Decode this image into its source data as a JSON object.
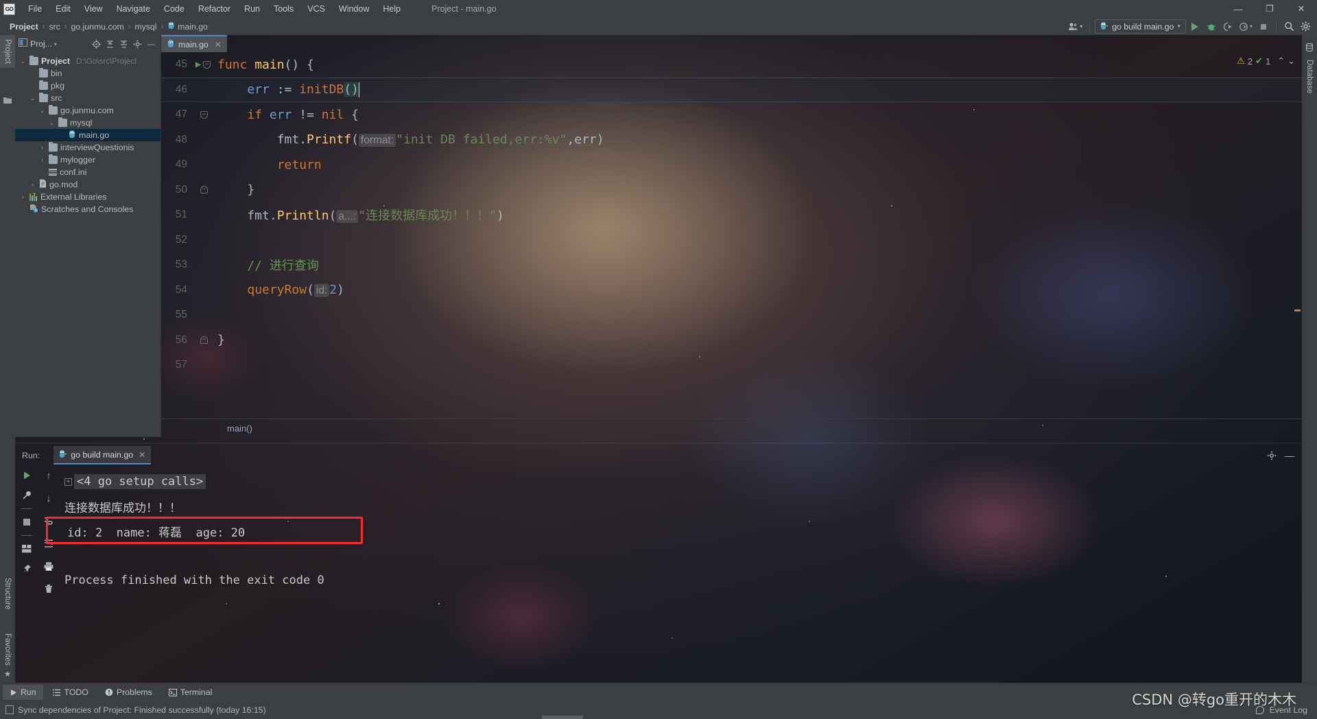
{
  "window": {
    "title": "Project - main.go",
    "logo": "GO",
    "controls": {
      "minimize": "—",
      "restore": "❐",
      "close": "✕"
    }
  },
  "menubar": {
    "items": [
      "File",
      "Edit",
      "View",
      "Navigate",
      "Code",
      "Refactor",
      "Run",
      "Tools",
      "VCS",
      "Window",
      "Help"
    ]
  },
  "navbar": {
    "crumbs": [
      "Project",
      "src",
      "go.junmu.com",
      "mysql",
      "main.go"
    ],
    "run_config": "go build main.go",
    "icons": [
      "user-group-icon",
      "run-icon",
      "debug-icon",
      "run-coverage-icon",
      "profile-icon",
      "stop-icon",
      "search-icon",
      "settings-icon"
    ]
  },
  "left_strip": {
    "top_tab": "Project",
    "bottom_tabs": [
      "Structure",
      "Favorites"
    ]
  },
  "right_strip": {
    "tabs": [
      "Database"
    ]
  },
  "project_panel": {
    "title": "Proj...",
    "toolbar_icons": [
      "locate-icon",
      "expand-all-icon",
      "collapse-all-icon",
      "settings-icon",
      "hide-icon"
    ],
    "tree": [
      {
        "label": "Project",
        "sub": "D:\\Go\\src\\Project",
        "icon": "folder-icon",
        "indent": 0,
        "arrow": "⌄",
        "bold": true
      },
      {
        "label": "bin",
        "sub": "",
        "icon": "folder-icon",
        "indent": 1,
        "arrow": ""
      },
      {
        "label": "pkg",
        "sub": "",
        "icon": "folder-icon",
        "indent": 1,
        "arrow": ""
      },
      {
        "label": "src",
        "sub": "",
        "icon": "folder-icon",
        "indent": 1,
        "arrow": "⌄"
      },
      {
        "label": "go.junmu.com",
        "sub": "",
        "icon": "folder-icon",
        "indent": 2,
        "arrow": "⌄"
      },
      {
        "label": "mysql",
        "sub": "",
        "icon": "folder-icon",
        "indent": 3,
        "arrow": "⌄"
      },
      {
        "label": "main.go",
        "sub": "",
        "icon": "go-file-icon",
        "indent": 4,
        "arrow": "",
        "selected": true
      },
      {
        "label": "interviewQuestionis",
        "sub": "",
        "icon": "folder-icon",
        "indent": 2,
        "arrow": "›"
      },
      {
        "label": "mylogger",
        "sub": "",
        "icon": "folder-icon",
        "indent": 2,
        "arrow": "›"
      },
      {
        "label": "conf.ini",
        "sub": "",
        "icon": "ini-file-icon",
        "indent": 2,
        "arrow": ""
      },
      {
        "label": "go.mod",
        "sub": "",
        "icon": "mod-file-icon",
        "indent": 1,
        "arrow": "›"
      },
      {
        "label": "External Libraries",
        "sub": "",
        "icon": "library-icon",
        "indent": 0,
        "arrow": "›"
      },
      {
        "label": "Scratches and Consoles",
        "sub": "",
        "icon": "scratches-icon",
        "indent": 0,
        "arrow": ""
      }
    ]
  },
  "editor": {
    "tab": {
      "label": "main.go",
      "icon": "go-file-icon",
      "close": "✕"
    },
    "inspections": {
      "warning_count": "2",
      "ok_count": "1",
      "warning_icon": "⚠",
      "ok_icon": "✔",
      "up": "⌃",
      "down": "⌄"
    },
    "breadcrumb": "main()",
    "lines": [
      {
        "num": "45",
        "tokens": [
          {
            "t": "func ",
            "c": "kw"
          },
          {
            "t": "main",
            "c": "fn"
          },
          {
            "t": "() {",
            "c": "ident"
          }
        ],
        "gutter": "run-icon",
        "fold": "minus"
      },
      {
        "num": "46",
        "tokens": [
          {
            "t": "    err ",
            "c": "blue"
          },
          {
            "t": ":= ",
            "c": "ident"
          },
          {
            "t": "initDB",
            "c": "fn-orange"
          },
          {
            "t": "()",
            "c": "paren-sel"
          },
          {
            "t": "|",
            "c": "caret"
          }
        ],
        "gutter": "",
        "fold": "",
        "current": true
      },
      {
        "num": "47",
        "tokens": [
          {
            "t": "    ",
            "c": "ident"
          },
          {
            "t": "if ",
            "c": "kw"
          },
          {
            "t": "err ",
            "c": "blue"
          },
          {
            "t": "!= ",
            "c": "ident"
          },
          {
            "t": "nil",
            "c": "kw"
          },
          {
            "t": " {",
            "c": "ident"
          }
        ],
        "gutter": "",
        "fold": "minus"
      },
      {
        "num": "48",
        "tokens": [
          {
            "t": "        fmt.",
            "c": "ident"
          },
          {
            "t": "Printf",
            "c": "fn"
          },
          {
            "t": "(",
            "c": "ident"
          },
          {
            "t": "format:",
            "c": "hint"
          },
          {
            "t": "\"init DB failed,err:%v\"",
            "c": "str"
          },
          {
            "t": ",err",
            "c": "ident"
          },
          {
            "t": ")",
            "c": "ident"
          }
        ],
        "gutter": "",
        "fold": ""
      },
      {
        "num": "49",
        "tokens": [
          {
            "t": "        ",
            "c": "ident"
          },
          {
            "t": "return",
            "c": "kw"
          }
        ],
        "gutter": "",
        "fold": ""
      },
      {
        "num": "50",
        "tokens": [
          {
            "t": "    }",
            "c": "ident"
          }
        ],
        "gutter": "",
        "fold": "minus-end"
      },
      {
        "num": "51",
        "tokens": [
          {
            "t": "    fmt.",
            "c": "ident"
          },
          {
            "t": "Println",
            "c": "fn"
          },
          {
            "t": "(",
            "c": "ident"
          },
          {
            "t": "a...:",
            "c": "hint"
          },
          {
            "t": "\"连接数据库成功！！！\"",
            "c": "str"
          },
          {
            "t": ")",
            "c": "ident"
          }
        ],
        "gutter": "",
        "fold": ""
      },
      {
        "num": "52",
        "tokens": [],
        "gutter": "",
        "fold": ""
      },
      {
        "num": "53",
        "tokens": [
          {
            "t": "    // 进行查询",
            "c": "com"
          }
        ],
        "gutter": "",
        "fold": ""
      },
      {
        "num": "54",
        "tokens": [
          {
            "t": "    ",
            "c": "ident"
          },
          {
            "t": "queryRow",
            "c": "fn-orange"
          },
          {
            "t": "(",
            "c": "ident"
          },
          {
            "t": "id:",
            "c": "hint"
          },
          {
            "t": "2",
            "c": "num"
          },
          {
            "t": ")",
            "c": "ident"
          }
        ],
        "gutter": "",
        "fold": ""
      },
      {
        "num": "55",
        "tokens": [],
        "gutter": "",
        "fold": ""
      },
      {
        "num": "56",
        "tokens": [
          {
            "t": "}",
            "c": "ident"
          }
        ],
        "gutter": "",
        "fold": "minus-end"
      },
      {
        "num": "57",
        "tokens": [],
        "gutter": "",
        "fold": ""
      }
    ]
  },
  "run_panel": {
    "label": "Run:",
    "tab": "go build main.go",
    "tab_close": "✕",
    "header_icons": [
      "settings-icon",
      "hide-icon"
    ],
    "toolbar_left": [
      "rerun-icon",
      "wrench-icon",
      "stop-icon",
      "layout-icon",
      "pin-icon"
    ],
    "toolbar_right": [
      "up-icon",
      "down-icon",
      "soft-wrap-icon",
      "scroll-end-icon",
      "print-icon",
      "trash-icon"
    ],
    "console": [
      {
        "text": "<4 go setup calls>",
        "style": "collapsed",
        "fold": "+"
      },
      {
        "text": "连接数据库成功！！！",
        "style": "plain"
      },
      {
        "text": "id: 2  name: 蒋磊  age: 20",
        "style": "highlighted"
      },
      {
        "text": "",
        "style": "plain"
      },
      {
        "text": "Process finished with the exit code 0",
        "style": "plain"
      }
    ],
    "highlight_color": "#ff2b2b"
  },
  "bottom_bar": {
    "buttons": [
      {
        "label": "Run",
        "icon": "run-icon",
        "selected": true
      },
      {
        "label": "TODO",
        "icon": "todo-icon",
        "selected": false
      },
      {
        "label": "Problems",
        "icon": "problems-icon",
        "selected": false
      },
      {
        "label": "Terminal",
        "icon": "terminal-icon",
        "selected": false
      }
    ]
  },
  "status_bar": {
    "message": "Sync dependencies of Project: Finished successfully (today 16:15)",
    "event_log": "Event Log"
  },
  "watermark": "CSDN @转go重开的木木",
  "colors": {
    "accent": "#4a88c7",
    "keyword": "#cc7832",
    "string": "#6a8759",
    "function": "#ffc66d",
    "comment": "#629755",
    "number": "#6897bb",
    "panel": "#3c3f41",
    "selection": "#0d293e",
    "highlight_red": "#ff2b2b"
  }
}
